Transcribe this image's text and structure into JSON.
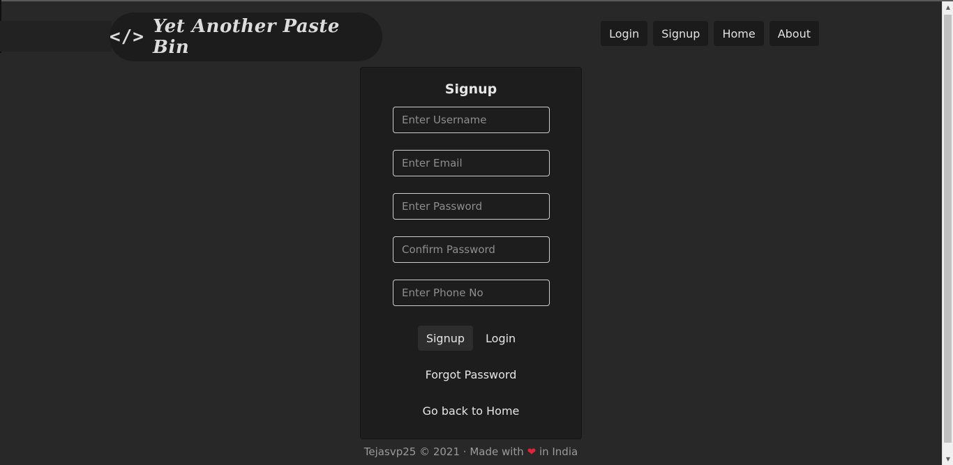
{
  "brand": {
    "icon": "</>",
    "title": "Yet Another Paste Bin"
  },
  "nav": [
    {
      "label": "Login"
    },
    {
      "label": "Signup"
    },
    {
      "label": "Home"
    },
    {
      "label": "About"
    }
  ],
  "signup": {
    "title": "Signup",
    "fields": {
      "username": {
        "placeholder": "Enter Username",
        "value": ""
      },
      "email": {
        "placeholder": "Enter Email",
        "value": ""
      },
      "password": {
        "placeholder": "Enter Password",
        "value": ""
      },
      "confirm_password": {
        "placeholder": "Confirm Password",
        "value": ""
      },
      "phone": {
        "placeholder": "Enter Phone No",
        "value": ""
      }
    },
    "signup_button": "Signup",
    "login_button": "Login",
    "forgot_password": "Forgot Password",
    "back_home": "Go back to Home"
  },
  "footer": {
    "prefix": "Tejasvp25 © 2021 · Made with",
    "heart": "❤",
    "suffix": "in India"
  },
  "colors": {
    "background": "#282828",
    "card": "#1d1d1d",
    "heart": "#e0243a"
  },
  "icons": {
    "brand": "code-icon",
    "heart": "heart-icon"
  }
}
